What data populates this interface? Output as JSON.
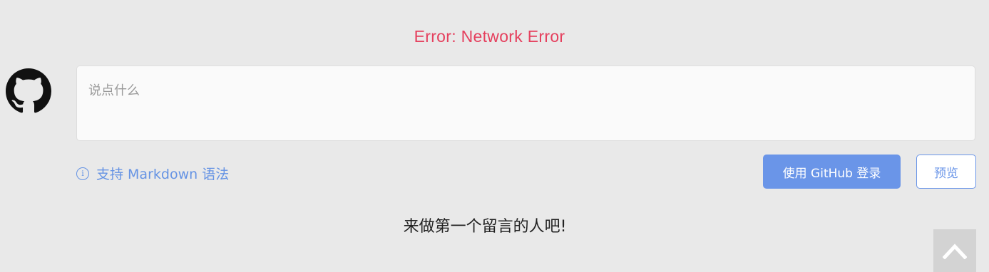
{
  "error": {
    "text": "Error: Network Error",
    "color": "#e5405e"
  },
  "avatar": {
    "icon": "github-icon"
  },
  "editor": {
    "placeholder": "说点什么",
    "value": ""
  },
  "markdown_hint": {
    "icon": "info-icon",
    "icon_glyph": "i",
    "label": "支持 Markdown 语法"
  },
  "actions": {
    "login_label": "使用 GitHub 登录",
    "preview_label": "预览"
  },
  "empty_message": "来做第一个留言的人吧!",
  "back_to_top": {
    "icon": "chevron-up-icon"
  },
  "colors": {
    "accent": "#6a95e8",
    "page_background": "#e9e9e9"
  }
}
